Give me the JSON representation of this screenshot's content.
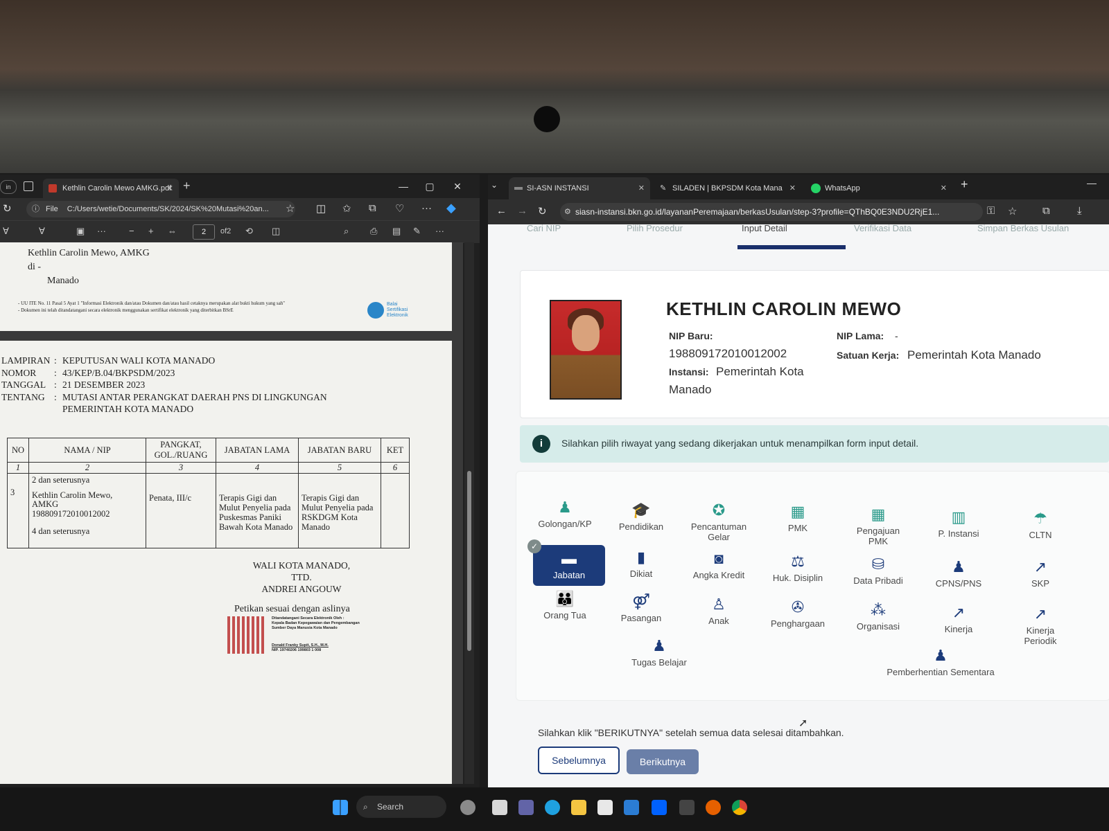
{
  "pdf": {
    "tab_title": "Kethlin Carolin Mewo AMKG.pdf",
    "address": "C:/Users/wetie/Documents/SK/2024/SK%20Mutasi%20an...",
    "address_prefix": "File",
    "page_current": "2",
    "page_total": "of2",
    "page1": {
      "line1": "Kethlin Carolin Mewo, AMKG",
      "line2": "di -",
      "line3": "Manado",
      "footnote1": "- UU ITE No. 11 Pasal 5 Ayat 1 \"Informasi Elektronik dan/atau Dokumen dan/atau hasil cetaknya merupakan alat bukti hukum yang sah\"",
      "footnote2": "- Dokumen ini telah ditandatangani secara elektronik menggunakan sertifikat elektronik yang diterbitkan BSrE",
      "bsre_logo": "Balai Sertifikasi Elektronik"
    },
    "page2": {
      "meta": [
        {
          "label": "LAMPIRAN",
          "sep": ":",
          "value": "KEPUTUSAN WALI KOTA MANADO"
        },
        {
          "label": "NOMOR",
          "sep": ":",
          "value": "43/KEP/B.04/BKPSDM/2023"
        },
        {
          "label": "TANGGAL",
          "sep": ":",
          "value": "21 DESEMBER 2023"
        },
        {
          "label": "TENTANG",
          "sep": ":",
          "value": "MUTASI ANTAR PERANGKAT DAERAH PNS DI LINGKUNGAN"
        },
        {
          "label": "",
          "sep": "",
          "value": "PEMERINTAH KOTA MANADO"
        }
      ],
      "table_headers": [
        "NO",
        "NAMA / NIP",
        "PANGKAT, GOL./RUANG",
        "JABATAN LAMA",
        "JABATAN BARU",
        "KET"
      ],
      "table_nums": [
        "1",
        "2",
        "3",
        "4",
        "5",
        "6"
      ],
      "row_pre": "2 dan seterusnya",
      "row_no": "3",
      "row_name": "Kethlin Carolin Mewo, AMKG",
      "row_nip": "198809172010012002",
      "row_post": "4 dan seterusnya",
      "row_pangkat": "Penata, III/c",
      "row_lama": "Terapis Gigi dan Mulut Penyelia pada Puskesmas Paniki Bawah Kota Manado",
      "row_baru": "Terapis Gigi dan Mulut Penyelia pada RSKDGM Kota Manado",
      "row_ket": "",
      "sign1": "WALI KOTA MANADO,",
      "sign2": "TTD.",
      "sign3": "ANDREI ANGOUW",
      "petikan": "Petikan sesuai dengan aslinya",
      "esign_title": "Ditandatangani Secara Elektronik Oleh :",
      "esign_org": "Kepala Badan Kepegawaian dan Pengembangan Sumber Daya Manusia Kota Manado",
      "esign_name": "Donald Franky Supit, S.H., M.H.",
      "esign_nip": "NIP. 19740206 199803 1 008"
    }
  },
  "browser": {
    "tabs": [
      {
        "label": "SI-ASN INSTANSI"
      },
      {
        "label": "SILADEN | BKPSDM Kota Mana"
      },
      {
        "label": "WhatsApp"
      }
    ],
    "url": "siasn-instansi.bkn.go.id/layananPeremajaan/berkasUsulan/step-3?profile=QThBQ0E3NDU2RjE1...",
    "steps": [
      "Cari NIP",
      "Pilih Prosedur",
      "Input Detail",
      "Verifikasi Data",
      "Simpan Berkas Usulan"
    ],
    "profile": {
      "name": "KETHLIN CAROLIN MEWO",
      "nip_baru_label": "NIP Baru:",
      "nip_baru": "198809172010012002",
      "instansi_label": "Instansi:",
      "instansi_line1": "Pemerintah Kota",
      "instansi_line2": "Manado",
      "nip_lama_label": "NIP Lama:",
      "nip_lama": "-",
      "satker_label": "Satuan Kerja:",
      "satker": "Pemerintah Kota Manado"
    },
    "info_text": "Silahkan pilih riwayat yang sedang dikerjakan untuk menampilkan form input detail.",
    "menu": {
      "golongan": "Golongan/KP",
      "pendidikan": "Pendidikan",
      "gelar1": "Pencantuman",
      "gelar2": "Gelar",
      "pmk": "PMK",
      "pengajuan1": "Pengajuan",
      "pengajuan2": "PMK",
      "pinstansi": "P. Instansi",
      "cltn": "CLTN",
      "jabatan": "Jabatan",
      "dikiat": "Dikiat",
      "angka": "Angka Kredit",
      "hukdis": "Huk. Disiplin",
      "datapribadi": "Data Pribadi",
      "cpns": "CPNS/PNS",
      "skp": "SKP",
      "ortu": "Orang Tua",
      "pasangan": "Pasangan",
      "anak": "Anak",
      "penghargaan": "Penghargaan",
      "organisasi": "Organisasi",
      "kinerja": "Kinerja",
      "kinerjap1": "Kinerja",
      "kinerjap2": "Periodik",
      "tugas": "Tugas Belajar",
      "pemberhentian": "Pemberhentian Sementara"
    },
    "footer_text": "Silahkan klik \"BERIKUTNYA\" setelah semua data selesai ditambahkan.",
    "btn_prev": "Sebelumnya",
    "btn_next": "Berikutnya"
  },
  "taskbar": {
    "search": "Search"
  },
  "colors": {
    "accent_navy": "#1c3b7a",
    "icon_teal": "#2a9a8a",
    "info_bg": "#d6ecea",
    "next_btn": "#6a7fa8"
  }
}
